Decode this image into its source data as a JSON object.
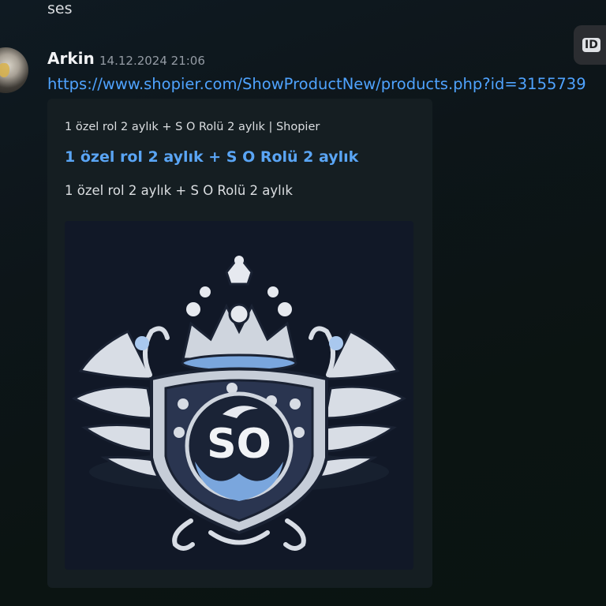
{
  "previous_message": {
    "text": "ses"
  },
  "message": {
    "author": "Arkin",
    "timestamp": "14.12.2024 21:06",
    "link_text": "https://www.shopier.com/ShowProductNew/products.php?id=3155739"
  },
  "id_badge": {
    "label": "ID"
  },
  "embed": {
    "provider": "1 özel rol 2 aylık + S O Rolü 2 aylık | Shopier",
    "title": "1 özel rol 2 aylık + S O Rolü 2 aylık",
    "description": "1 özel rol 2 aylık + S O Rolü 2 aylık",
    "image": {
      "logo_text": "SO",
      "accent_color": "#8fb6e8"
    }
  },
  "colors": {
    "link": "#4fa3ff",
    "embed_title": "#5aa5f5",
    "embed_background": "#151e22",
    "page_background": "#0d1519"
  }
}
